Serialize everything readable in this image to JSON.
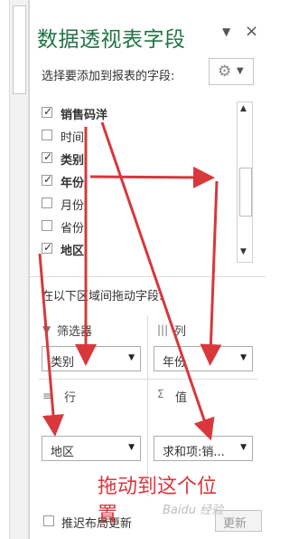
{
  "pane": {
    "title": "数据透视表字段",
    "dropdown_glyph": "▼",
    "close_glyph": "×",
    "subtitle": "选择要添加到报表的字段:",
    "gear_glyph": "⚙",
    "gear_caret": "▼"
  },
  "fields": [
    {
      "label": "销售码洋",
      "checked": true,
      "bold": true
    },
    {
      "label": "时间",
      "checked": false,
      "bold": false
    },
    {
      "label": "类别",
      "checked": true,
      "bold": true
    },
    {
      "label": "年份",
      "checked": true,
      "bold": true
    },
    {
      "label": "月份",
      "checked": false,
      "bold": false
    },
    {
      "label": "省份",
      "checked": false,
      "bold": false
    },
    {
      "label": "地区",
      "checked": true,
      "bold": true
    }
  ],
  "check_glyph": "✓",
  "scroll": {
    "up": "▲",
    "down": "▼"
  },
  "areas": {
    "caption": "在以下区域间拖动字段:",
    "filters": {
      "icon": "filter-icon",
      "glyph": "▼",
      "label": "筛选器",
      "value": "类别"
    },
    "columns": {
      "icon": "columns-icon",
      "glyph": "|||",
      "label": "列",
      "value": "年份"
    },
    "rows": {
      "icon": "rows-icon",
      "glyph": "≡",
      "label": "行",
      "value": "地区"
    },
    "values": {
      "icon": "sigma-icon",
      "glyph": "Σ",
      "label": "值",
      "value": "求和项:销..."
    },
    "dropdown_glyph": "▼"
  },
  "footer": {
    "defer_label": "推迟布局更新",
    "update_label": "更新"
  },
  "annotation": {
    "line1": "拖动到这个位",
    "line2": "置",
    "color": "#d8373c"
  },
  "watermark": "Baidu 经验"
}
